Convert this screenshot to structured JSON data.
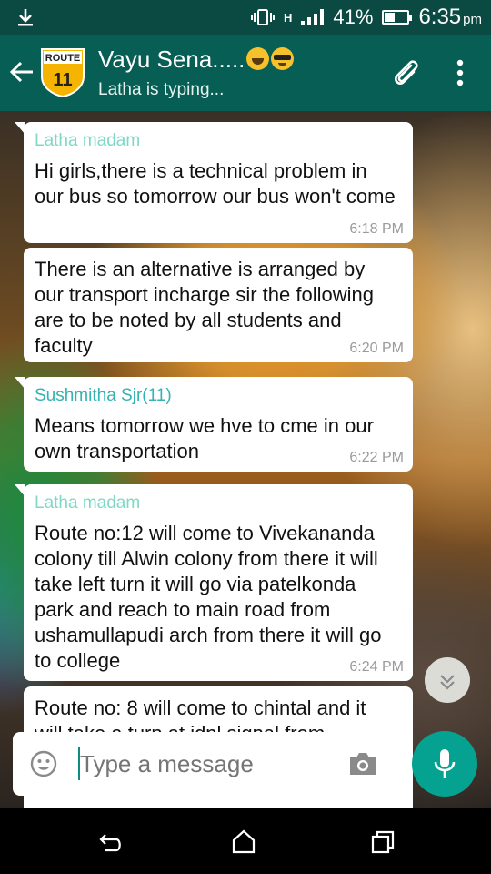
{
  "status_bar": {
    "battery_percent": "41%",
    "battery_level": 0.41,
    "time": "6:35",
    "time_suffix": "pm",
    "network_label": "H"
  },
  "header": {
    "title": "Vayu Sena.....",
    "subtitle": "Latha is typing...",
    "avatar_text_top": "ROUTE",
    "avatar_text_number": "11",
    "icons": [
      "back-arrow-icon",
      "route-sign-avatar",
      "grinning-face-emoji",
      "sunglasses-face-emoji",
      "paperclip-icon",
      "more-vert-icon"
    ]
  },
  "messages": [
    {
      "sender": "Latha madam",
      "text": "Hi girls,there is a technical problem in our bus so tomorrow our bus won't come",
      "time": "6:18 PM"
    },
    {
      "sender": "",
      "text": "There is an alternative is arranged by our transport incharge sir the following are to be noted by all students and faculty",
      "time": "6:20 PM"
    },
    {
      "sender": "Sushmitha Sjr(11)",
      "text": "Means tomorrow we hve to cme in our own transportation",
      "time": "6:22 PM"
    },
    {
      "sender": "Latha madam",
      "text": "Route no:12 will come to Vivekananda colony till Alwin colony from there it will take left turn it will go via patelkonda park and reach to main road from ushamullapudi arch from there it will go to college",
      "time": "6:24 PM"
    },
    {
      "sender": "",
      "text": "Route no: 8 will come to chintal and it will take a turn at idpl signal from",
      "time": ""
    }
  ],
  "composer": {
    "placeholder": "Type a message"
  },
  "colors": {
    "app_bar": "#075e54",
    "status_bar": "#0a4a43",
    "accent": "#05a291",
    "sender_latha": "#7fd8c6",
    "sender_sushmitha": "#35b3b0"
  }
}
